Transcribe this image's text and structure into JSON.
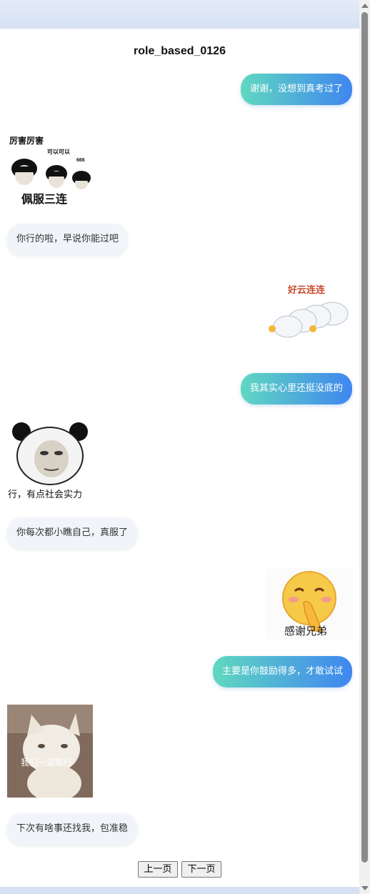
{
  "title": "role_based_0126",
  "messages": [
    {
      "side": "right",
      "type": "text",
      "text": "谢谢，没想到真考过了"
    },
    {
      "side": "left",
      "type": "sticker",
      "sticker": "bowl-cut-meme-sticker",
      "caption_top": "厉害厉害",
      "caption_mid": "可以可以",
      "caption_small": "666",
      "caption_bottom": "佩服三连"
    },
    {
      "side": "left",
      "type": "text",
      "text": "你行的啦，早说你能过吧"
    },
    {
      "side": "right",
      "type": "sticker",
      "sticker": "cloud-thumbs-up-sticker",
      "caption": "好云连连"
    },
    {
      "side": "right",
      "type": "text",
      "text": "我其实心里还挺没底的"
    },
    {
      "side": "left",
      "type": "sticker",
      "sticker": "panda-face-sticker",
      "caption": "行，有点社会实力"
    },
    {
      "side": "left",
      "type": "text",
      "text": "你每次都小瞧自己，真服了"
    },
    {
      "side": "right",
      "type": "sticker",
      "sticker": "smiling-emoji-sticker",
      "caption": "感谢兄弟"
    },
    {
      "side": "right",
      "type": "text",
      "text": "主要是你鼓励得多，才敢试试"
    },
    {
      "side": "left",
      "type": "sticker",
      "sticker": "cat-sticker",
      "caption": "我们一定能行"
    },
    {
      "side": "left",
      "type": "text",
      "text": "下次有啥事还找我，包准稳"
    }
  ],
  "pagination": {
    "prev": "上一页",
    "next": "下一页"
  },
  "colors": {
    "bubble_right_start": "#60d8c0",
    "bubble_right_end": "#3f86f0",
    "bubble_left": "#f1f4f9",
    "page_bg": "#dce6f6"
  }
}
